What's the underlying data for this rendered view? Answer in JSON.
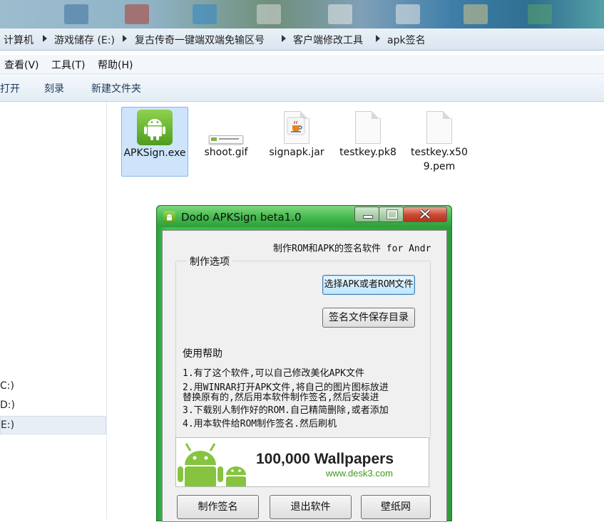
{
  "breadcrumb": [
    "计算机",
    "游戏储存 (E:)",
    "复古传奇一键端双端免输区号",
    "客户端修改工具",
    "apk签名"
  ],
  "menu": [
    "查看(V)",
    "工具(T)",
    "帮助(H)"
  ],
  "toolbar": [
    "打开",
    "刻录",
    "新建文件夹"
  ],
  "nav": {
    "drives": [
      "C:)",
      "D:)",
      "E:)"
    ]
  },
  "files": [
    {
      "name": "APKSign.exe",
      "icon": "android-app-icon"
    },
    {
      "name": "shoot.gif",
      "icon": "gif-image-icon"
    },
    {
      "name": "signapk.jar",
      "icon": "java-jar-icon"
    },
    {
      "name": "testkey.pk8",
      "icon": "blank-file-icon"
    },
    {
      "name": "testkey.x509.pem",
      "icon": "blank-file-icon"
    }
  ],
  "dialog": {
    "title": "Dodo APKSign beta1.0",
    "subtitle": "制作ROM和APK的签名软件 for Andr",
    "group_title": "制作选项",
    "select_button": "选择APK或者ROM文件",
    "save_dir_button": "签名文件保存目录",
    "help_title": "使用帮助",
    "help_lines": [
      "1.有了这个软件,可以自己修改美化APK文件",
      "2.用WINRAR打开APK文件,将自己的图片图标放进",
      "替换原有的,然后用本软件制作签名,然后安装进",
      "3.下载别人制作好的ROM.自己精简删除,或者添加",
      "4.用本软件给ROM制作签名.然后刷机"
    ],
    "banner": {
      "headline": "100,000 Wallpapers",
      "url": "www.desk3.com"
    },
    "buttons": [
      "制作签名",
      "退出软件",
      "壁纸网"
    ]
  },
  "colors": {
    "dialog_frame": "#2e9e3b",
    "selection": "#cde4fb",
    "android_green": "#8ac53f"
  }
}
